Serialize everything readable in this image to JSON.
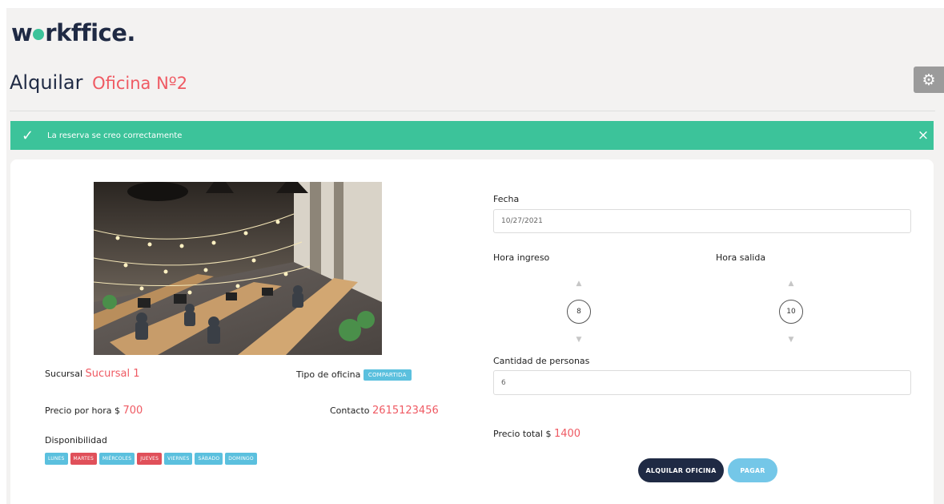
{
  "brand": {
    "logo_pre": "w",
    "logo_post": "rkffice."
  },
  "header": {
    "title": "Alquilar",
    "office_name": "Oficina Nº2"
  },
  "alert": {
    "message": "La reserva se creo correctamente",
    "close_symbol": "×"
  },
  "office": {
    "branch_label": "Sucursal",
    "branch_value": "Sucursal 1",
    "type_label": "Tipo de oficina",
    "type_value": "COMPARTIDA",
    "price_label": "Precio por hora $",
    "price_value": "700",
    "contact_label": "Contacto",
    "contact_value": "2615123456",
    "availability_label": "Disponibilidad",
    "days": [
      {
        "label": "LUNES",
        "available": true
      },
      {
        "label": "MARTES",
        "available": false
      },
      {
        "label": "MIÉRCOLES",
        "available": true
      },
      {
        "label": "JUEVES",
        "available": false
      },
      {
        "label": "VIERNES",
        "available": true
      },
      {
        "label": "SÁBADO",
        "available": true
      },
      {
        "label": "DOMINGO",
        "available": true
      }
    ]
  },
  "form": {
    "date_label": "Fecha",
    "date_value": "10/27/2021",
    "hour_in_label": "Hora ingreso",
    "hour_in_value": "8",
    "hour_out_label": "Hora salida",
    "hour_out_value": "10",
    "people_label": "Cantidad de personas",
    "people_value": "6",
    "total_label": "Precio total $",
    "total_value": "1400",
    "rent_button": "ALQUILAR OFICINA",
    "pay_button": "PAGAR"
  },
  "icons": {
    "settings": "gear-icon",
    "alert": "check-icon",
    "close": "close-icon",
    "up": "arrow-up-icon",
    "down": "arrow-down-icon"
  },
  "colors": {
    "accent": "#3cc39a",
    "red": "#ef5a63",
    "navy": "#1f2a44",
    "blue_tag": "#5bc0de",
    "red_tag": "#e0505a"
  }
}
